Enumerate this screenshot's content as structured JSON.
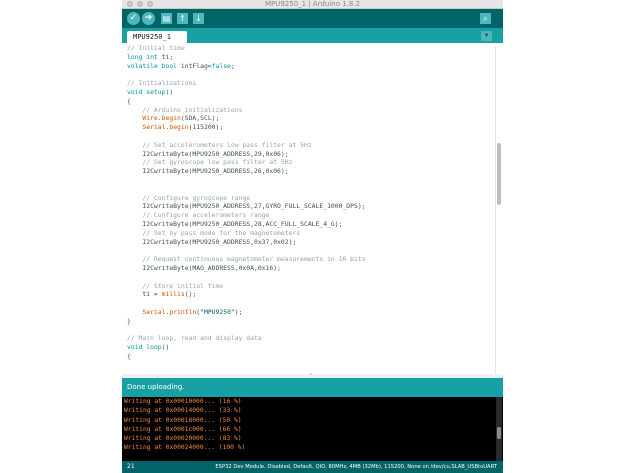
{
  "window": {
    "title": "MPU9250_1 | Arduino 1.8.2"
  },
  "toolbar": {
    "verify_icon": "checkmark-icon",
    "upload_icon": "arrow-right-icon",
    "new_icon": "new-file-icon",
    "open_icon": "open-arrow-up-icon",
    "save_icon": "save-arrow-down-icon",
    "serial_monitor_icon": "magnifier-icon",
    "verify_glyph": "✓",
    "upload_glyph": "➜",
    "new_glyph": "▤",
    "open_glyph": "↑",
    "save_glyph": "↓",
    "serial_glyph": "⌕"
  },
  "tabs": {
    "active_label": "MPU9250_1",
    "menu_glyph": "▼"
  },
  "editor": {
    "lines": [
      [
        [
          "cm",
          "// Initial time"
        ]
      ],
      [
        [
          "kw",
          "long int"
        ],
        [
          "tx",
          " ti;"
        ]
      ],
      [
        [
          "kw",
          "volatile bool"
        ],
        [
          "tx",
          " intFlag="
        ],
        [
          "kw",
          "false"
        ],
        [
          "tx",
          ";"
        ]
      ],
      [
        [
          "tx",
          ""
        ]
      ],
      [
        [
          "cm",
          "// Initializations"
        ]
      ],
      [
        [
          "kw",
          "void"
        ],
        [
          "tx",
          " "
        ],
        [
          "kw",
          "setup"
        ],
        [
          "tx",
          "()"
        ]
      ],
      [
        [
          "tx",
          "{"
        ]
      ],
      [
        [
          "cm",
          "    // Arduino initializations"
        ]
      ],
      [
        [
          "tx",
          "    "
        ],
        [
          "fn",
          "Wire"
        ],
        [
          "tx",
          "."
        ],
        [
          "fn",
          "begin"
        ],
        [
          "tx",
          "(SDA,SCL);"
        ]
      ],
      [
        [
          "tx",
          "    "
        ],
        [
          "fn",
          "Serial"
        ],
        [
          "tx",
          "."
        ],
        [
          "fn",
          "begin"
        ],
        [
          "tx",
          "(115200);"
        ]
      ],
      [
        [
          "tx",
          ""
        ]
      ],
      [
        [
          "cm",
          "    // Set accelerometers low pass filter at 5Hz"
        ]
      ],
      [
        [
          "tx",
          "    I2CwriteByte(MPU9250_ADDRESS,29,0x06);"
        ]
      ],
      [
        [
          "cm",
          "    // Set gyroscope low pass filter at 5Hz"
        ]
      ],
      [
        [
          "tx",
          "    I2CwriteByte(MPU9250_ADDRESS,26,0x06);"
        ]
      ],
      [
        [
          "tx",
          ""
        ]
      ],
      [
        [
          "tx",
          ""
        ]
      ],
      [
        [
          "cm",
          "    // Configure gyroscope range"
        ]
      ],
      [
        [
          "tx",
          "    I2CwriteByte(MPU9250_ADDRESS,27,GYRO_FULL_SCALE_1000_DPS);"
        ]
      ],
      [
        [
          "cm",
          "    // Configure accelerometers range"
        ]
      ],
      [
        [
          "tx",
          "    I2CwriteByte(MPU9250_ADDRESS,28,ACC_FULL_SCALE_4_G);"
        ]
      ],
      [
        [
          "cm",
          "    // Set by pass mode for the magnetometers"
        ]
      ],
      [
        [
          "tx",
          "    I2CwriteByte(MPU9250_ADDRESS,0x37,0x02);"
        ]
      ],
      [
        [
          "tx",
          ""
        ]
      ],
      [
        [
          "cm",
          "    // Request continuous magnetometer measurements in 16 bits"
        ]
      ],
      [
        [
          "tx",
          "    I2CwriteByte(MAG_ADDRESS,0x0A,0x16);"
        ]
      ],
      [
        [
          "tx",
          ""
        ]
      ],
      [
        [
          "cm",
          "    // Store initial time"
        ]
      ],
      [
        [
          "tx",
          "    ti = "
        ],
        [
          "fn",
          "millis"
        ],
        [
          "tx",
          "();"
        ]
      ],
      [
        [
          "tx",
          ""
        ]
      ],
      [
        [
          "tx",
          "    "
        ],
        [
          "fn",
          "Serial"
        ],
        [
          "tx",
          "."
        ],
        [
          "fn",
          "println"
        ],
        [
          "tx",
          "("
        ],
        [
          "str",
          "\"MPU9250\""
        ],
        [
          "tx",
          ");"
        ]
      ],
      [
        [
          "tx",
          "}"
        ]
      ],
      [
        [
          "tx",
          ""
        ]
      ],
      [
        [
          "cm",
          "// Main loop, read and display data"
        ]
      ],
      [
        [
          "kw",
          "void"
        ],
        [
          "tx",
          " "
        ],
        [
          "kw",
          "loop"
        ],
        [
          "tx",
          "()"
        ]
      ],
      [
        [
          "tx",
          "{"
        ]
      ]
    ]
  },
  "divider": {
    "grip": "⌃"
  },
  "status": {
    "message": "Done uploading."
  },
  "console": {
    "lines": [
      "Writing at 0x00010000... (16 %)",
      "Writing at 0x00014000... (33 %)",
      "Writing at 0x00018000... (50 %)",
      "Writing at 0x0001c000... (66 %)",
      "Writing at 0x00020000... (83 %)",
      "Writing at 0x00024000... (100 %)"
    ]
  },
  "footer": {
    "line_number": "21",
    "board_info": "ESP32 Dev Module, Disabled, Default, QIO, 80MHz, 4MB (32Mb), 115200, None on /dev/cu.SLAB_USBtoUART"
  }
}
